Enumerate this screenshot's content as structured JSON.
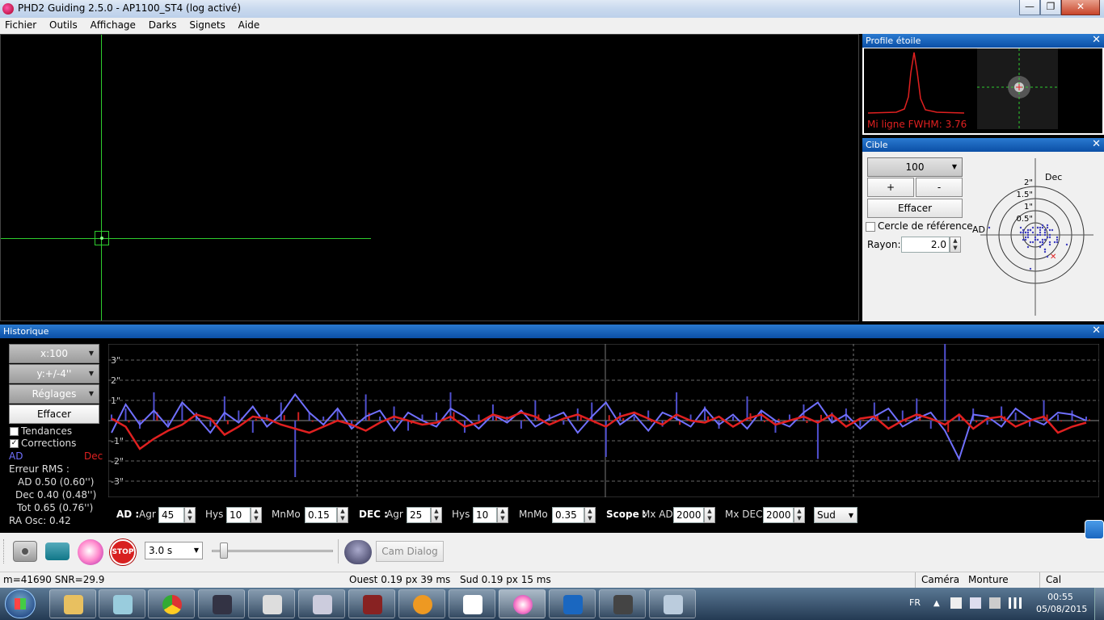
{
  "window": {
    "title": "PHD2 Guiding 2.5.0 - AP1100_ST4 (log activé)",
    "minimize": "—",
    "maximize": "❐",
    "close": "✕"
  },
  "menu": [
    "Fichier",
    "Outils",
    "Affichage",
    "Darks",
    "Signets",
    "Aide"
  ],
  "profile": {
    "title": "Profile étoile",
    "fwhm_label": "Mi ligne FWHM: 3.76"
  },
  "target": {
    "title": "Cible",
    "scale_value": "100",
    "plus_label": "+",
    "minus_label": "-",
    "clear_label": "Effacer",
    "ref_circle_label": "Cercle de référence",
    "radius_label": "Rayon:",
    "radius_value": "2.0",
    "dec_label": "Dec",
    "ad_label": "AD",
    "ring_labels": [
      "2\"",
      "1.5\"",
      "1\"",
      "0.5\""
    ]
  },
  "history": {
    "title": "Historique",
    "x_scale": "x:100",
    "y_scale": "y:+/-4''",
    "settings": "Réglages",
    "clear": "Effacer",
    "trends_label": "Tendances",
    "corrections_label": "Corrections",
    "ad_legend": "AD",
    "dec_legend": "Dec",
    "rms_title": "Erreur RMS :",
    "rms_ad": "AD 0.50 (0.60'')",
    "rms_dec": "Dec 0.40 (0.48'')",
    "rms_tot": "Tot 0.65 (0.76'')",
    "ra_osc": "RA Osc: 0.42",
    "y_ticks": [
      "3\"",
      "2\"",
      "1\"",
      "-1\"",
      "-2\"",
      "-3\""
    ]
  },
  "params": {
    "ad_label": "AD :",
    "agr_label": "Agr",
    "ad_agr": "45",
    "hys_label": "Hys",
    "ad_hys": "10",
    "mnmo_label": "MnMo",
    "ad_mnmo": "0.15",
    "dec_label": "DEC :",
    "dec_agr": "25",
    "dec_hys": "10",
    "dec_mnmo": "0.35",
    "scope_label": "Scope :",
    "mx_ad_label": "Mx AD",
    "mx_ad": "2000",
    "mx_dec_label": "Mx DEC",
    "mx_dec": "2000",
    "dec_mode": "Sud"
  },
  "toolbar": {
    "exposure": "3.0 s",
    "stop_label": "STOP",
    "cam_dialog": "Cam Dialog"
  },
  "status": {
    "star_info": "m=41690 SNR=29.9",
    "ouest": "Ouest  0.19 px  39 ms",
    "sud": "Sud 0.19 px 15 ms",
    "camera": "Caméra",
    "monture": "Monture",
    "cal": "Cal"
  },
  "taskbar": {
    "lang": "FR",
    "time": "00:55",
    "date": "05/08/2015"
  },
  "chart_data": {
    "type": "line",
    "series": [
      {
        "name": "AD",
        "color": "#7070ff",
        "values": [
          -0.6,
          0.8,
          -0.2,
          0.5,
          -0.3,
          0.9,
          0.2,
          -0.6,
          0.4,
          -0.1,
          0.7,
          -0.3,
          0.3,
          1.3,
          0.4,
          -0.2,
          0.6,
          -0.4,
          0.2,
          0.5,
          -0.5,
          0.4,
          0.0,
          -0.3,
          0.6,
          0.2,
          -0.4,
          0.3,
          -0.1,
          0.5,
          -0.3,
          0.1,
          0.4,
          -0.6,
          0.2,
          0.9,
          -0.2,
          0.3,
          -0.5,
          0.4,
          0.1,
          -0.3,
          0.6,
          -0.2,
          0.3,
          -0.4,
          0.5,
          0.0,
          -0.3,
          0.4,
          0.9,
          -0.1,
          0.3,
          -0.4,
          0.2,
          0.6,
          -0.3,
          0.1,
          0.4,
          -0.5,
          -1.9,
          0.3,
          0.2,
          -0.3,
          0.6,
          0.1,
          -0.2,
          0.4,
          0.3,
          0.0
        ]
      },
      {
        "name": "Dec",
        "color": "#e02020",
        "values": [
          0.1,
          -0.3,
          -1.4,
          -0.9,
          -0.5,
          -0.2,
          0.3,
          0.1,
          -0.7,
          -0.3,
          0.2,
          0.1,
          -0.2,
          -0.4,
          -0.6,
          -0.3,
          0.0,
          -0.2,
          -0.5,
          -0.1,
          0.2,
          0.0,
          -0.2,
          -0.1,
          0.2,
          -0.3,
          -0.1,
          0.3,
          0.1,
          0.4,
          0.2,
          -0.2,
          0.1,
          0.3,
          0.0,
          -0.3,
          0.2,
          0.4,
          0.1,
          -0.2,
          0.3,
          0.0,
          -0.1,
          0.2,
          -0.3,
          0.1,
          0.3,
          -0.2,
          0.0,
          0.2,
          -0.1,
          0.3,
          -0.3,
          0.1,
          0.2,
          -0.4,
          0.0,
          0.3,
          0.1,
          -0.2,
          0.3,
          -0.4,
          0.1,
          0.2,
          -0.3,
          0.0,
          0.2,
          -0.6,
          -0.3,
          -0.1
        ]
      }
    ],
    "corrections": [
      0.3,
      0.6,
      -0.4,
      1.4,
      -0.2,
      0.8,
      0.4,
      -0.3,
      1.2,
      0.5,
      -0.6,
      0.3,
      0.9,
      -2.8,
      0.4,
      0.2,
      0.6,
      -0.3,
      1.3,
      0.2,
      0.7,
      -0.5,
      0.3,
      0.4,
      1.4,
      -0.6,
      0.3,
      0.8,
      0.2,
      -0.4,
      1.0,
      0.3,
      -0.2,
      0.6,
      0.9,
      -1.8,
      0.4,
      0.2,
      0.5,
      -0.3,
      1.4,
      0.3,
      0.7,
      -0.4,
      0.2,
      1.2,
      0.5,
      -0.6,
      0.3,
      0.8,
      -1.9,
      0.4,
      0.6,
      -0.3,
      0.9,
      0.2,
      0.5,
      1.1,
      -0.4,
      3.8,
      0.3,
      0.6,
      -0.2,
      0.7,
      0.4,
      -0.3,
      1.0,
      0.3,
      0.5,
      0.2
    ],
    "ylim": [
      -4,
      4
    ],
    "y_unit": "arcsec"
  }
}
